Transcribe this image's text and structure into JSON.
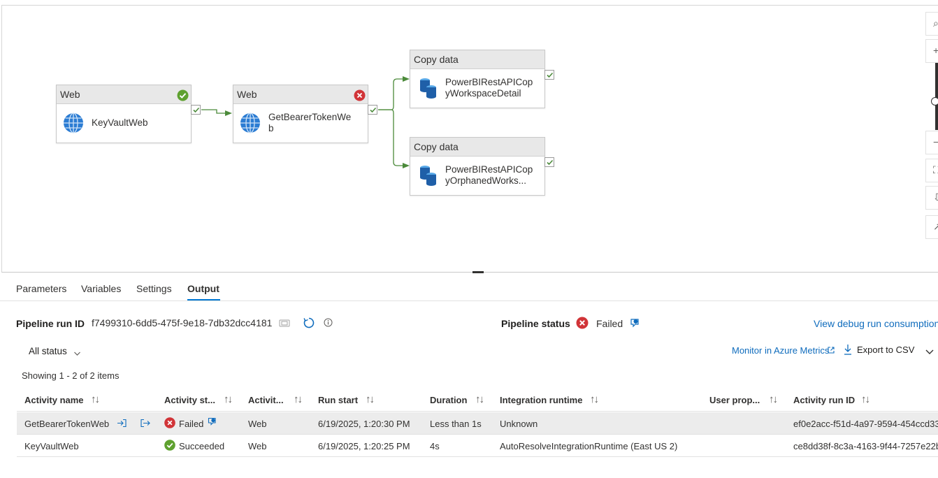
{
  "pipeline": {
    "nodes": [
      {
        "type": "Web",
        "name": "KeyVaultWeb",
        "status": "succeeded"
      },
      {
        "type": "Web",
        "name": "GetBearerTokenWeb",
        "status": "failed"
      },
      {
        "type": "Copy data",
        "name": "PowerBIRestAPICopyWorkspaceDetail",
        "status": "none"
      },
      {
        "type": "Copy data",
        "name": "PowerBIRestAPICopyOrphanedWorks...",
        "status": "none"
      }
    ],
    "toolbar": [
      "search-icon",
      "zoom-in-icon",
      "zoom-out-icon",
      "fit-to-window-icon",
      "auto-align-icon",
      "expand-icon"
    ]
  },
  "tabs": [
    {
      "label": "Parameters"
    },
    {
      "label": "Variables"
    },
    {
      "label": "Settings"
    },
    {
      "label": "Output",
      "active": true
    }
  ],
  "output": {
    "run_id_label": "Pipeline run ID",
    "run_id": "f7499310-6dd5-475f-9e18-7db32dcc4181",
    "status_label": "Pipeline status",
    "status": "Failed",
    "debug_link": "View debug run consumption",
    "filter": "All status",
    "monitor_link": "Monitor in Azure Metrics",
    "export_label": "Export to CSV",
    "showing": "Showing 1 - 2 of 2 items"
  },
  "table": {
    "columns": [
      "Activity name",
      "Activity st...",
      "Activit...",
      "Run start",
      "Duration",
      "Integration runtime",
      "User prop...",
      "Activity run ID"
    ],
    "rows": [
      {
        "name": "GetBearerTokenWeb",
        "status": "Failed",
        "type": "Web",
        "run_start": "6/19/2025, 1:20:30 PM",
        "duration": "Less than 1s",
        "runtime": "Unknown",
        "user_props": "",
        "run_id": "ef0e2acc-f51d-4a97-9594-454ccd33"
      },
      {
        "name": "KeyVaultWeb",
        "status": "Succeeded",
        "type": "Web",
        "run_start": "6/19/2025, 1:20:25 PM",
        "duration": "4s",
        "runtime": "AutoResolveIntegrationRuntime (East US 2)",
        "user_props": "",
        "run_id": "ce8dd38f-8c3a-4163-9f44-7257e22b"
      }
    ]
  },
  "colors": {
    "accent": "#0078d4",
    "success": "#5ea12f",
    "error": "#d13438",
    "link": "#0f6cbd"
  }
}
